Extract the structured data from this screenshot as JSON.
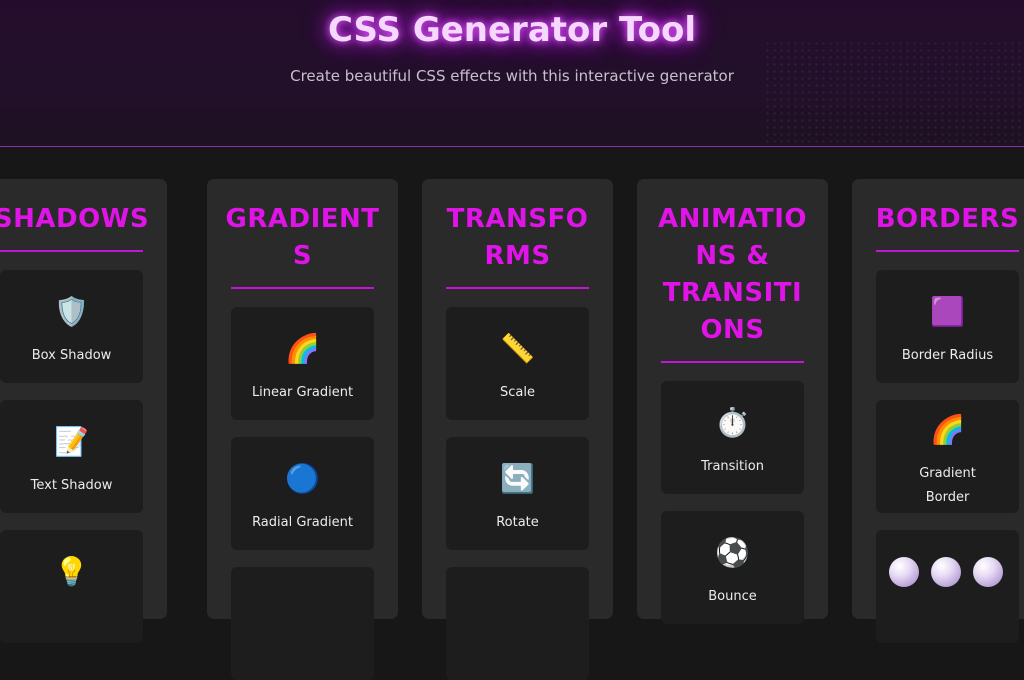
{
  "header": {
    "title": "CSS Generator Tool",
    "subtitle": "Create beautiful CSS effects with this interactive generator"
  },
  "columns": [
    {
      "heading_lines": [
        "SHADOWS"
      ],
      "items": [
        {
          "icon": "shield-icon",
          "glyph": "🛡️",
          "label_lines": [
            "Box Shadow"
          ]
        },
        {
          "icon": "memo-icon",
          "glyph": "📝",
          "label_lines": [
            "Text Shadow"
          ]
        },
        {
          "icon": "lightbulb-icon",
          "glyph": "💡",
          "label_lines": []
        }
      ]
    },
    {
      "heading_lines": [
        "GRADIENT",
        "S"
      ],
      "items": [
        {
          "icon": "rainbow-icon",
          "glyph": "🌈",
          "label_lines": [
            "Linear Gradient"
          ]
        },
        {
          "icon": "blue-circle-icon",
          "glyph": "🔵",
          "label_lines": [
            "Radial Gradient"
          ]
        },
        {
          "icon": "",
          "glyph": "",
          "label_lines": []
        }
      ]
    },
    {
      "heading_lines": [
        "TRANSFO",
        "RMS"
      ],
      "items": [
        {
          "icon": "ruler-icon",
          "glyph": "📏",
          "label_lines": [
            "Scale"
          ]
        },
        {
          "icon": "rotate-arrows-icon",
          "glyph": "🔄",
          "label_lines": [
            "Rotate"
          ]
        },
        {
          "icon": "",
          "glyph": "",
          "label_lines": []
        }
      ]
    },
    {
      "heading_lines": [
        "ANIMATIO",
        "NS &",
        "TRANSITI",
        "ONS"
      ],
      "items": [
        {
          "icon": "stopwatch-icon",
          "glyph": "⏱️",
          "label_lines": [
            "Transition"
          ]
        },
        {
          "icon": "soccer-ball-icon",
          "glyph": "⚽",
          "label_lines": [
            "Bounce"
          ]
        }
      ]
    },
    {
      "heading_lines": [
        "BORDERS"
      ],
      "items": [
        {
          "icon": "purple-square-icon",
          "glyph": "🟪",
          "label_lines": [
            "Border Radius"
          ]
        },
        {
          "icon": "rainbow-icon",
          "glyph": "🌈",
          "label_lines": [
            "Gradient",
            "Border"
          ]
        },
        {
          "icon": "pearls-icon",
          "glyph": "",
          "label_lines": []
        }
      ]
    }
  ],
  "colors": {
    "accent": "#e013e8",
    "background": "#171717",
    "panel": "#2a2a2a",
    "card": "#1d1d1d"
  }
}
